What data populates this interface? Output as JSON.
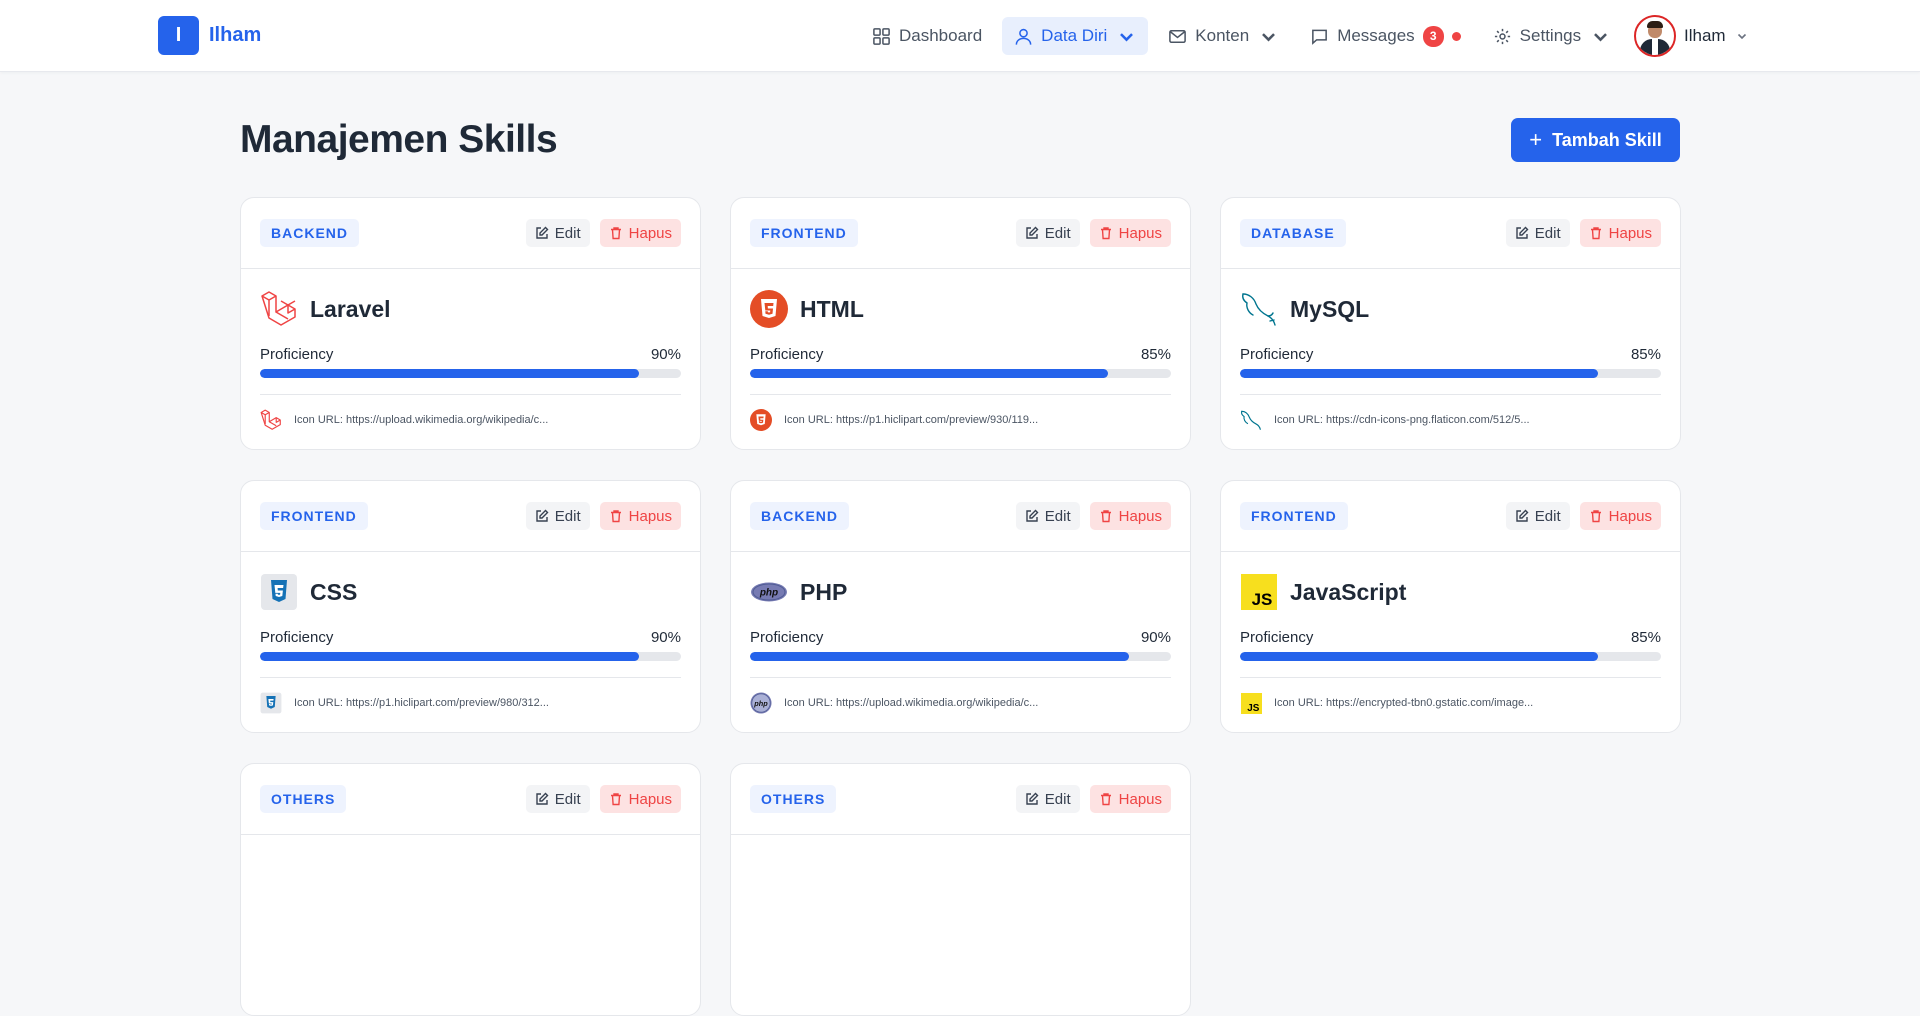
{
  "brand": {
    "logo_letter": "I",
    "name": "Ilham"
  },
  "nav": {
    "items": [
      {
        "label": "Dashboard",
        "icon": "grid-icon"
      },
      {
        "label": "Data Diri",
        "icon": "user-icon",
        "active": true
      },
      {
        "label": "Konten",
        "icon": "mail-icon"
      },
      {
        "label": "Messages",
        "icon": "chat-icon",
        "badge": "3"
      },
      {
        "label": "Settings",
        "icon": "settings-icon"
      }
    ],
    "user_name": "Ilham"
  },
  "page": {
    "title": "Manajemen Skills",
    "add_button": "Tambah Skill"
  },
  "labels": {
    "edit": "Edit",
    "delete": "Hapus",
    "proficiency": "Proficiency"
  },
  "skills": [
    {
      "category": "BACKEND",
      "name": "Laravel",
      "percent": "90%",
      "value": 90,
      "icon": "laravel-icon",
      "url_text": "Icon URL: https://upload.wikimedia.org/wikipedia/c..."
    },
    {
      "category": "FRONTEND",
      "name": "HTML",
      "percent": "85%",
      "value": 85,
      "icon": "html5-icon",
      "url_text": "Icon URL: https://p1.hiclipart.com/preview/930/119..."
    },
    {
      "category": "DATABASE",
      "name": "MySQL",
      "percent": "85%",
      "value": 85,
      "icon": "mysql-dolphin-icon",
      "url_text": "Icon URL: https://cdn-icons-png.flaticon.com/512/5..."
    },
    {
      "category": "FRONTEND",
      "name": "CSS",
      "percent": "90%",
      "value": 90,
      "icon": "css3-icon",
      "url_text": "Icon URL: https://p1.hiclipart.com/preview/980/312..."
    },
    {
      "category": "BACKEND",
      "name": "PHP",
      "percent": "90%",
      "value": 90,
      "icon": "php-icon",
      "url_text": "Icon URL: https://upload.wikimedia.org/wikipedia/c..."
    },
    {
      "category": "FRONTEND",
      "name": "JavaScript",
      "percent": "85%",
      "value": 85,
      "icon": "javascript-icon",
      "url_text": "Icon URL: https://encrypted-tbn0.gstatic.com/image..."
    },
    {
      "category": "OTHERS"
    },
    {
      "category": "OTHERS"
    }
  ],
  "colors": {
    "primary": "#2563eb",
    "danger": "#ef4444",
    "background": "#f6f7f9"
  }
}
